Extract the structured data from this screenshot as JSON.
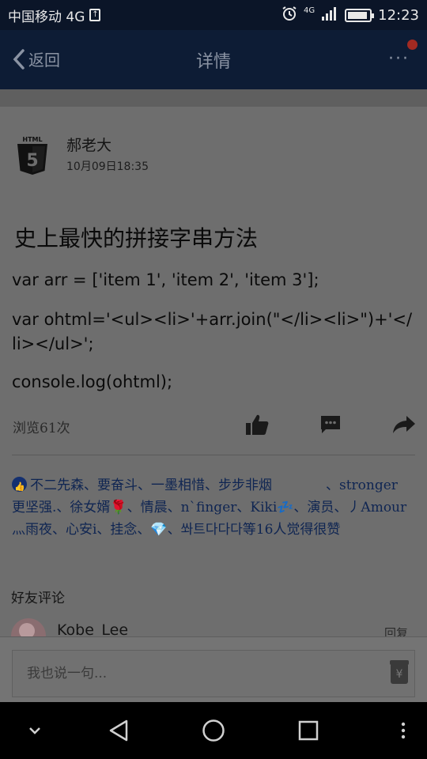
{
  "status_bar": {
    "carrier": "中国移动 4G",
    "upload_glyph": "↑",
    "network": "4G",
    "time": "12:23"
  },
  "header": {
    "back_label": "返回",
    "title": "详情",
    "more_label": "···"
  },
  "post": {
    "author": "郝老大",
    "date": "10月09日18:35",
    "title": "史上最快的拼接字串方法",
    "lines": [
      "var arr = ['item 1', 'item 2', 'item 3'];",
      "var ohtml='<ul><li>'+arr.join(\"</li><li>\")+'</li></ul>';",
      "console.log(ohtml);"
    ],
    "views": "浏览61次"
  },
  "likes_text": "不二先森、要奋斗、一墨相惜、步步非烟　　　　、stronger 更坚强.、徐女婿🌹、情晨、n`finger、Kiki💤、演员、丿Amour灬雨夜、心安i、挂念、💎、쏴트다다다等16人觉得很赞",
  "comments": {
    "title": "好友评论",
    "items": [
      {
        "name": "Kobe_Lee",
        "reply": "回复"
      }
    ]
  },
  "input": {
    "placeholder": "我也说一句..."
  },
  "icons": {
    "avatar": "html5-logo-icon",
    "like": "thumbs-up-icon",
    "comment": "comment-icon",
    "share": "share-icon",
    "reward": "reward-icon"
  },
  "colors": {
    "header_bg": "#0d1c35",
    "overlay_bg": "#6e6e6e",
    "likes_text": "#0f2552",
    "red_dot": "#a22a22"
  }
}
